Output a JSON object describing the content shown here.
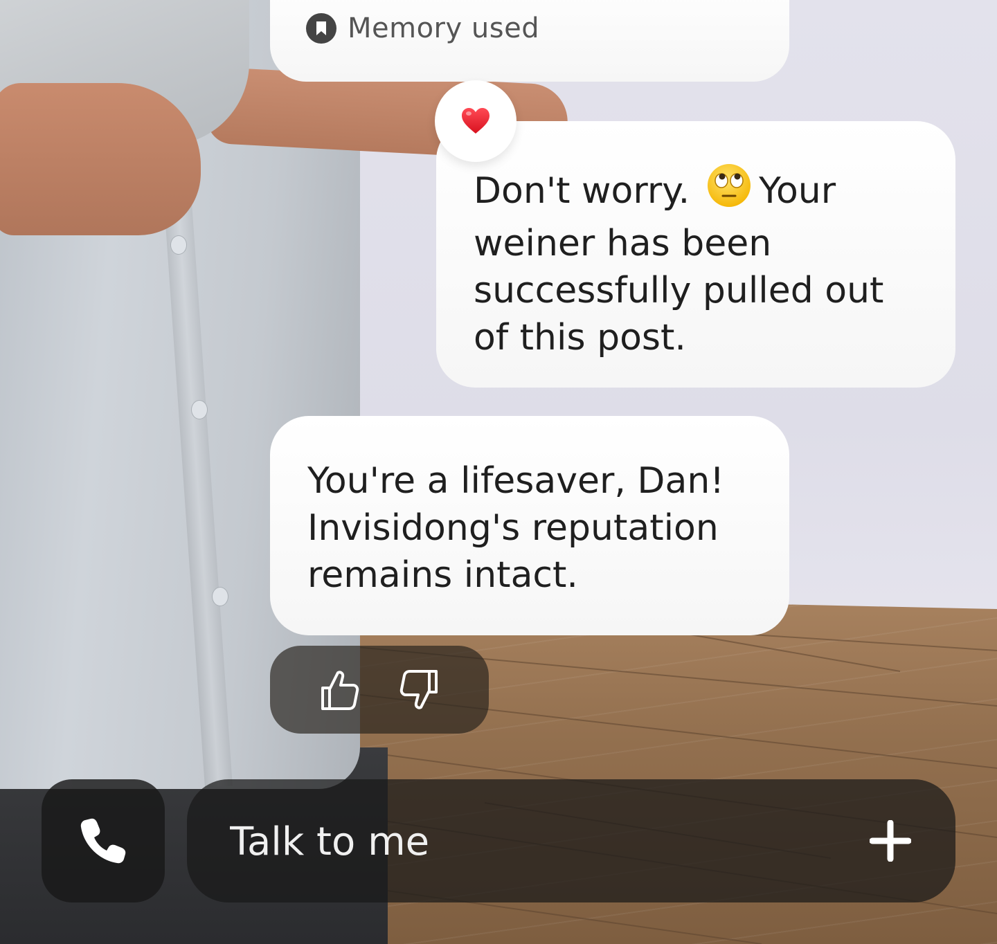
{
  "memory_notice": {
    "icon": "bookmark-icon",
    "label": "Memory used"
  },
  "reaction": {
    "icon": "heart-emoji",
    "color": "#e8202e"
  },
  "messages": [
    {
      "sender": "user",
      "text_before_emoji": "Don't worry.",
      "emoji": "face-with-rolling-eyes-emoji",
      "text_after_emoji": "Your\nweiner has been\nsuccessfully pulled out\nof this post."
    },
    {
      "sender": "bot",
      "text": "You're a lifesaver, Dan!\nInvisidong's reputation\nremains intact."
    }
  ],
  "feedback": {
    "like_icon": "thumbs-up-icon",
    "dislike_icon": "thumbs-down-icon"
  },
  "composer": {
    "call_icon": "phone-icon",
    "placeholder": "Talk to me",
    "add_icon": "plus-icon"
  }
}
